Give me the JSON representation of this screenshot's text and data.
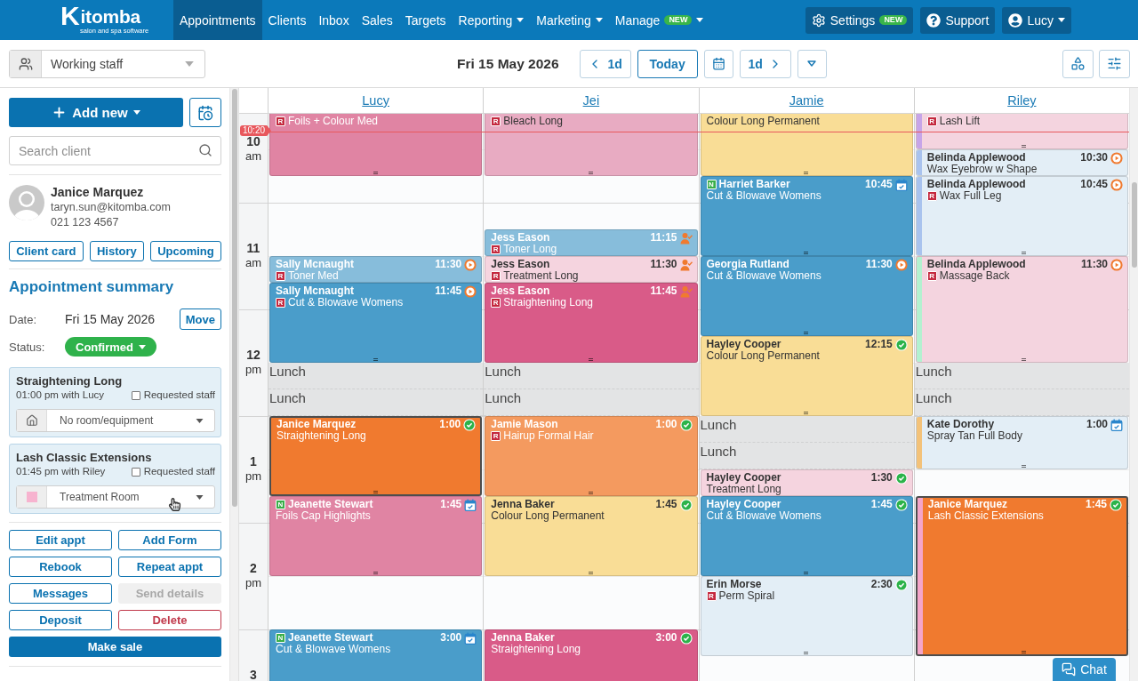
{
  "nav": {
    "logo": {
      "wordmark": "Kitomba",
      "tagline": "salon and spa software"
    },
    "items": [
      {
        "label": "Appointments",
        "selected": true,
        "dropdown": false
      },
      {
        "label": "Clients",
        "selected": false,
        "dropdown": false
      },
      {
        "label": "Inbox",
        "selected": false,
        "dropdown": false
      },
      {
        "label": "Sales",
        "selected": false,
        "dropdown": false
      },
      {
        "label": "Targets",
        "selected": false,
        "dropdown": false
      },
      {
        "label": "Reporting",
        "selected": false,
        "dropdown": true
      },
      {
        "label": "Marketing",
        "selected": false,
        "dropdown": true
      },
      {
        "label": "Manage",
        "badge": "NEW",
        "selected": false,
        "dropdown": true
      }
    ],
    "tools": [
      {
        "kind": "settings",
        "label": "Settings",
        "badge": "NEW",
        "dropdown": false
      },
      {
        "kind": "support",
        "label": "Support",
        "dropdown": false
      },
      {
        "kind": "user",
        "label": "Lucy",
        "dropdown": true
      }
    ]
  },
  "toolbar": {
    "staff_filter": "Working staff",
    "date": "Fri 15 May 2026",
    "prev": "1d",
    "today": "Today",
    "next": "1d"
  },
  "sidebar": {
    "add_button": "Add new",
    "search": {
      "placeholder": "Search client"
    },
    "client": {
      "name": "Janice Marquez",
      "email": "taryn.sun@kitomba.com",
      "phone": "021 123 4567"
    },
    "client_buttons": [
      "Client card",
      "History",
      "Upcoming"
    ],
    "summary": {
      "title": "Appointment summary",
      "date_label": "Date:",
      "date": "Fri 15 May 2026",
      "move": "Move",
      "status_label": "Status:",
      "status": {
        "label": "Confirmed",
        "kind": "confirmed"
      }
    },
    "services": [
      {
        "name": "Straightening Long",
        "when": "01:00 pm with Lucy",
        "requested_label": "Requested staff",
        "requested": false,
        "resource": {
          "label": "No room/equipment",
          "kind": "none"
        }
      },
      {
        "name": "Lash Classic Extensions",
        "when": "01:45 pm with Riley",
        "requested_label": "Requested staff",
        "requested": false,
        "resource": {
          "label": "Treatment Room",
          "kind": "room",
          "color": "#f7b3cf"
        }
      }
    ],
    "actions": [
      {
        "label": "Edit appt",
        "kind": "default",
        "disabled": false
      },
      {
        "label": "Add Form",
        "kind": "default",
        "disabled": false
      },
      {
        "label": "Rebook",
        "kind": "default",
        "disabled": false
      },
      {
        "label": "Repeat appt",
        "kind": "default",
        "disabled": false
      },
      {
        "label": "Messages",
        "kind": "default",
        "disabled": false
      },
      {
        "label": "Send details",
        "kind": "default",
        "disabled": true
      },
      {
        "label": "Deposit",
        "kind": "default",
        "disabled": false
      },
      {
        "label": "Delete",
        "kind": "danger",
        "disabled": false
      }
    ],
    "make_sale": "Make sale"
  },
  "calendar": {
    "now": "10:20",
    "hours": [
      {
        "hour": "10",
        "period": "am"
      },
      {
        "hour": "11",
        "period": "am"
      },
      {
        "hour": "12",
        "period": "pm"
      },
      {
        "hour": "1",
        "period": "pm"
      },
      {
        "hour": "2",
        "period": "pm"
      },
      {
        "hour": "3"
      }
    ],
    "staff": [
      {
        "name": "Lucy",
        "blocks": [
          {
            "kind": "continued",
            "service": "Foils + Colour Med",
            "service_badge": {
              "label": "R",
              "color": "#c4283e"
            },
            "color": "#e084a3"
          },
          {
            "kind": "appointment",
            "client": "Sally Mcnaught",
            "service": "Toner Med",
            "service_badge": {
              "label": "R",
              "color": "#c4283e"
            },
            "time": "11:30",
            "status": {
              "kind": "arrived"
            },
            "color": "#87bddb",
            "selected": false
          },
          {
            "kind": "appointment",
            "client": "Sally Mcnaught",
            "service": "Cut & Blowave Womens",
            "service_badge": {
              "label": "R",
              "color": "#c4283e"
            },
            "time": "11:45",
            "status": {
              "kind": "arrived"
            },
            "color": "#4a9dca",
            "selected": false
          },
          {
            "kind": "lunch",
            "label": "Lunch"
          },
          {
            "kind": "lunch",
            "label": "Lunch"
          },
          {
            "kind": "appointment",
            "client": "Janice Marquez",
            "service": "Straightening Long",
            "time": "1:00",
            "status": {
              "kind": "confirmed"
            },
            "color": "#f07a2f",
            "selected": true
          },
          {
            "kind": "appointment",
            "client": "Jeanette Stewart",
            "client_badge": {
              "label": "N",
              "color": "#3aae4a"
            },
            "service": "Foils Cap Highlights",
            "time": "1:45",
            "status": {
              "kind": "online"
            },
            "color": "#e084a3",
            "selected": false
          },
          {
            "kind": "appointment",
            "client": "Jeanette Stewart",
            "client_badge": {
              "label": "N",
              "color": "#3aae4a"
            },
            "service": "Cut & Blowave Womens",
            "time": "3:00",
            "status": {
              "kind": "online"
            },
            "color": "#4a9dca",
            "selected": false
          }
        ]
      },
      {
        "name": "Jei",
        "blocks": [
          {
            "kind": "continued",
            "service": "Bleach Long",
            "service_badge": {
              "label": "R",
              "color": "#c4283e"
            },
            "color": "#e8abc2"
          },
          {
            "kind": "appointment",
            "client": "Jess Eason",
            "service": "Toner Long",
            "service_badge": {
              "label": "R",
              "color": "#c4283e"
            },
            "time": "11:15",
            "status": {
              "kind": "requested"
            },
            "color": "#87bddb",
            "selected": false
          },
          {
            "kind": "appointment",
            "client": "Jess Eason",
            "service": "Treatment Long",
            "service_badge": {
              "label": "R",
              "color": "#c4283e"
            },
            "time": "11:30",
            "status": {
              "kind": "requested"
            },
            "color": "#f5d4df",
            "selected": false
          },
          {
            "kind": "appointment",
            "client": "Jess Eason",
            "service": "Straightening Long",
            "service_badge": {
              "label": "R",
              "color": "#c4283e"
            },
            "time": "11:45",
            "status": {
              "kind": "requested"
            },
            "color": "#d95b88",
            "selected": false
          },
          {
            "kind": "lunch",
            "label": "Lunch"
          },
          {
            "kind": "lunch",
            "label": "Lunch"
          },
          {
            "kind": "appointment",
            "client": "Jamie Mason",
            "service": "Hairup Formal Hair",
            "service_badge": {
              "label": "R",
              "color": "#c4283e"
            },
            "time": "1:00",
            "status": {
              "kind": "confirmed"
            },
            "color": "#f49a5f",
            "selected": false
          },
          {
            "kind": "appointment",
            "client": "Jenna Baker",
            "service": "Colour Long Permanent",
            "time": "1:45",
            "status": {
              "kind": "confirmed"
            },
            "color": "#f9dd96",
            "selected": false
          },
          {
            "kind": "appointment",
            "client": "Jenna Baker",
            "service": "Straightening Long",
            "time": "3:00",
            "status": {
              "kind": "confirmed"
            },
            "color": "#d95b88",
            "selected": false
          }
        ]
      },
      {
        "name": "Jamie",
        "blocks": [
          {
            "kind": "continued",
            "service": "Colour Long Permanent",
            "color": "#f9dd96"
          },
          {
            "kind": "appointment",
            "client": "Harriet Barker",
            "client_badge": {
              "label": "N",
              "color": "#3aae4a"
            },
            "service": "Cut & Blowave Womens",
            "time": "10:45",
            "status": {
              "kind": "online"
            },
            "color": "#4a9dca",
            "selected": false
          },
          {
            "kind": "appointment",
            "client": "Georgia Rutland",
            "service": "Cut & Blowave Womens",
            "time": "11:30",
            "status": {
              "kind": "arrived"
            },
            "color": "#4a9dca",
            "selected": false
          },
          {
            "kind": "appointment",
            "client": "Hayley Cooper",
            "service": "Colour Long Permanent",
            "time": "12:15",
            "status": {
              "kind": "confirmed"
            },
            "color": "#f9dd96",
            "selected": false
          },
          {
            "kind": "lunch",
            "label": "Lunch"
          },
          {
            "kind": "lunch",
            "label": "Lunch"
          },
          {
            "kind": "appointment",
            "client": "Hayley Cooper",
            "service": "Treatment Long",
            "time": "1:30",
            "status": {
              "kind": "confirmed"
            },
            "color": "#f5d4df",
            "selected": false
          },
          {
            "kind": "appointment",
            "client": "Hayley Cooper",
            "service": "Cut & Blowave Womens",
            "time": "1:45",
            "status": {
              "kind": "confirmed"
            },
            "color": "#4a9dca",
            "selected": false
          },
          {
            "kind": "appointment",
            "client": "Erin Morse",
            "service": "Perm Spiral",
            "service_badge": {
              "label": "R",
              "color": "#c4283e"
            },
            "time": "2:30",
            "status": {
              "kind": "confirmed"
            },
            "color": "#e3eef6",
            "selected": false
          }
        ]
      },
      {
        "name": "Riley",
        "blocks": [
          {
            "kind": "continued",
            "service": "Lash Lift",
            "service_badge": {
              "label": "R",
              "color": "#c4283e"
            },
            "color": "#f4d4df",
            "stripe": {
              "color": "#c7a5e8"
            }
          },
          {
            "kind": "appointment",
            "client": "Belinda Applewood",
            "service": "Wax Eyebrow w Shape",
            "time": "10:30",
            "status": {
              "kind": "arrived"
            },
            "color": "#e3eef6",
            "stripe": {
              "color": "#a9c3ee"
            },
            "selected": false
          },
          {
            "kind": "appointment",
            "client": "Belinda Applewood",
            "service": "Wax Full Leg",
            "service_badge": {
              "label": "R",
              "color": "#c4283e"
            },
            "time": "10:45",
            "status": {
              "kind": "arrived"
            },
            "color": "#e3eef6",
            "stripe": {
              "color": "#a9c3ee"
            },
            "selected": false
          },
          {
            "kind": "appointment",
            "client": "Belinda Applewood",
            "service": "Massage Back",
            "service_badge": {
              "label": "R",
              "color": "#c4283e"
            },
            "time": "11:30",
            "status": {
              "kind": "arrived"
            },
            "color": "#f4d4df",
            "stripe": {
              "color": "#b3f1d0"
            },
            "selected": false
          },
          {
            "kind": "lunch",
            "label": "Lunch"
          },
          {
            "kind": "lunch",
            "label": "Lunch"
          },
          {
            "kind": "appointment",
            "client": "Kate Dorothy",
            "service": "Spray Tan Full Body",
            "time": "1:00",
            "status": {
              "kind": "online"
            },
            "color": "#e3eef6",
            "stripe": {
              "color": "#f3c27a"
            },
            "selected": false
          },
          {
            "kind": "appointment",
            "client": "Janice Marquez",
            "service": "Lash Classic Extensions",
            "time": "1:45",
            "status": {
              "kind": "confirmed"
            },
            "color": "#f07a2f",
            "stripe": {
              "color": "#f5a5c9"
            },
            "selected": true
          }
        ]
      }
    ],
    "chat": "Chat"
  }
}
